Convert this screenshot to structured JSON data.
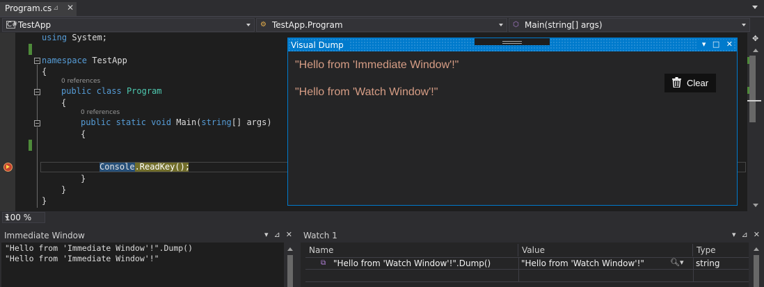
{
  "tab": {
    "title": "Program.cs",
    "pin_glyph": "⊿",
    "close_glyph": "✕"
  },
  "navbar": {
    "project": "TestApp",
    "project_icon": "C#",
    "class": "TestApp.Program",
    "member": "Main(string[] args)"
  },
  "editor": {
    "lines": {
      "using_kw": "using",
      "using_ns": " System;",
      "namespace_kw": "namespace",
      "namespace_name": " TestApp",
      "open_brace1": "{",
      "ref1": "0 references",
      "public1": "public",
      "class_kw": " class",
      "class_name": " Program",
      "open_brace2": "{",
      "ref2": "0 references",
      "public2": "public",
      "static_kw": " static",
      "void_kw": " void",
      "main_sig": " Main(",
      "string_kw": "string",
      "main_rest": "[] args)",
      "open_brace3": "{",
      "console": "Console",
      "readkey": ".ReadKey();",
      "close_brace3": "}",
      "close_brace2": "}",
      "close_brace1": "}"
    },
    "zoom": "100 %"
  },
  "visual_dump": {
    "title": "Visual Dump",
    "line1": "\"Hello from 'Immediate Window'!\"",
    "line2": "\"Hello from 'Watch Window'!\"",
    "clear_label": "Clear",
    "controls": {
      "dropdown": "▾",
      "maximize": "□",
      "close": "✕"
    }
  },
  "immediate": {
    "title": "Immediate Window",
    "lines": [
      "\"Hello from 'Immediate Window'!\".Dump()",
      "\"Hello from 'Immediate Window'!\""
    ]
  },
  "watch": {
    "title": "Watch 1",
    "columns": {
      "name": "Name",
      "value": "Value",
      "type": "Type"
    },
    "rows": [
      {
        "name": "\"Hello from 'Watch Window'!\".Dump()",
        "value": "\"Hello from 'Watch Window'!\"",
        "type": "string"
      }
    ]
  },
  "panel_controls": {
    "dropdown": "▾",
    "pin": "⊿",
    "close": "✕"
  },
  "colors": {
    "accent": "#007acc",
    "string": "#d69d85",
    "keyword": "#569cd6",
    "type": "#4ec9b0",
    "breakpoint": "#c5442f"
  }
}
